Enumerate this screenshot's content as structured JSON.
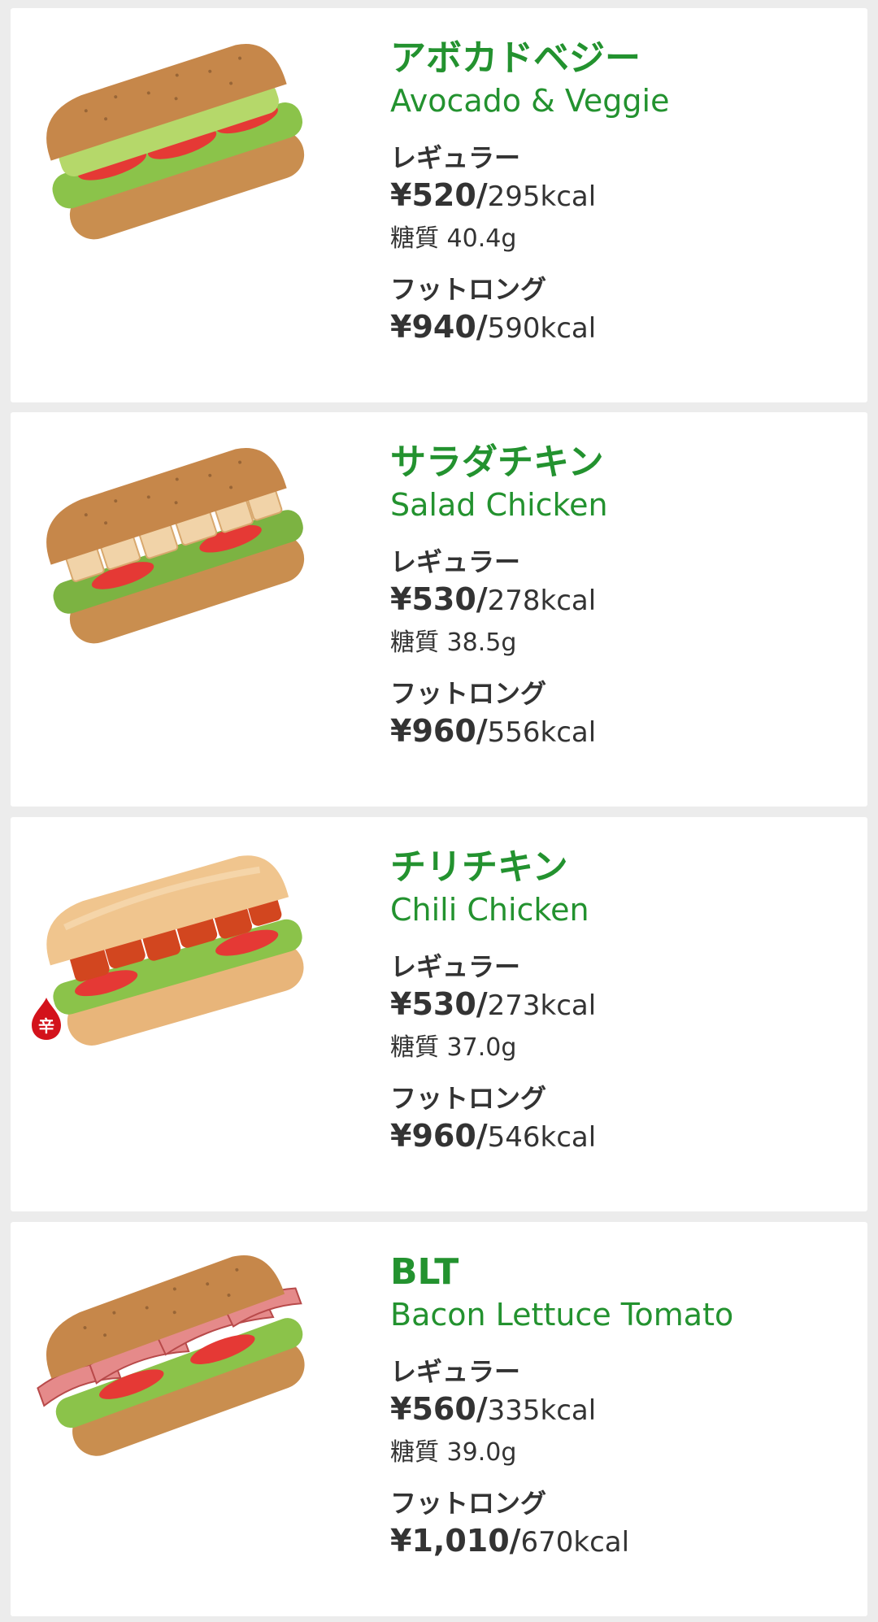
{
  "colors": {
    "accent_green": "#23922f",
    "text_dark": "#333333",
    "background": "#ececec",
    "card": "#ffffff",
    "spicy_red": "#d3121b"
  },
  "products": [
    {
      "name_ja": "アボカドベジー",
      "name_en": "Avocado & Veggie",
      "image": "avocado-veggie-sandwich-image",
      "regular_label": "レギュラー",
      "regular_price": "¥520/",
      "regular_kcal": "295kcal",
      "sugar": "糖質 40.4g",
      "footlong_label": "フットロング",
      "footlong_price": "¥940/",
      "footlong_kcal": "590kcal"
    },
    {
      "name_ja": "サラダチキン",
      "name_en": "Salad Chicken",
      "image": "salad-chicken-sandwich-image",
      "regular_label": "レギュラー",
      "regular_price": "¥530/",
      "regular_kcal": "278kcal",
      "sugar": "糖質 38.5g",
      "footlong_label": "フットロング",
      "footlong_price": "¥960/",
      "footlong_kcal": "556kcal"
    },
    {
      "name_ja": "チリチキン",
      "name_en": "Chili Chicken",
      "image": "chili-chicken-sandwich-image",
      "badge": "辛",
      "regular_label": "レギュラー",
      "regular_price": "¥530/",
      "regular_kcal": "273kcal",
      "sugar": "糖質 37.0g",
      "footlong_label": "フットロング",
      "footlong_price": "¥960/",
      "footlong_kcal": "546kcal"
    },
    {
      "name_ja": "BLT",
      "name_en": "Bacon Lettuce Tomato",
      "image": "blt-sandwich-image",
      "regular_label": "レギュラー",
      "regular_price": "¥560/",
      "regular_kcal": "335kcal",
      "sugar": "糖質 39.0g",
      "footlong_label": "フットロング",
      "footlong_price": "¥1,010/",
      "footlong_kcal": "670kcal"
    }
  ]
}
